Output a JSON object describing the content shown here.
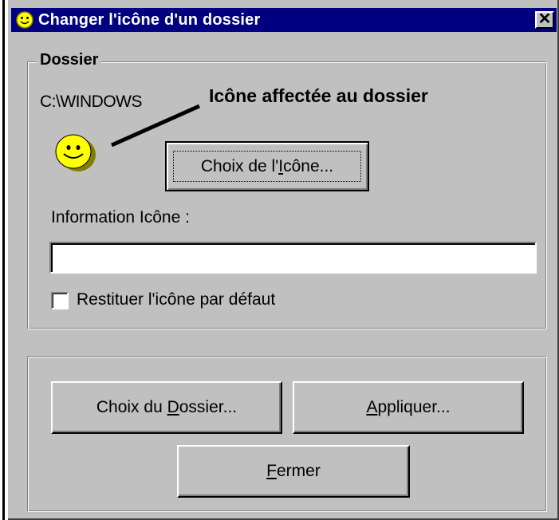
{
  "window": {
    "title": "Changer l'icône d'un dossier",
    "close_label": "✕"
  },
  "group_dossier": {
    "legend": "Dossier",
    "path": "C:\\WINDOWS",
    "annotation": "Icône affectée au dossier",
    "choose_icon_button": {
      "before": "Choix de l'",
      "mnemonic": "I",
      "after": "cône..."
    },
    "info_label": "Information Icône :",
    "info_value": "",
    "restore_checkbox_label": "Restituer l'icône par défaut",
    "restore_checked": false
  },
  "buttons": {
    "choose_folder": {
      "before": "Choix du ",
      "mnemonic": "D",
      "after": "ossier..."
    },
    "apply": {
      "before": "",
      "mnemonic": "A",
      "after": "ppliquer..."
    },
    "close": {
      "before": "",
      "mnemonic": "F",
      "after": "ermer"
    }
  },
  "colors": {
    "titlebar": "#000080",
    "face": "#c0c0c0",
    "smiley": "#ffff00"
  },
  "icons": [
    "smiley-icon",
    "close-icon",
    "checkbox-icon"
  ]
}
